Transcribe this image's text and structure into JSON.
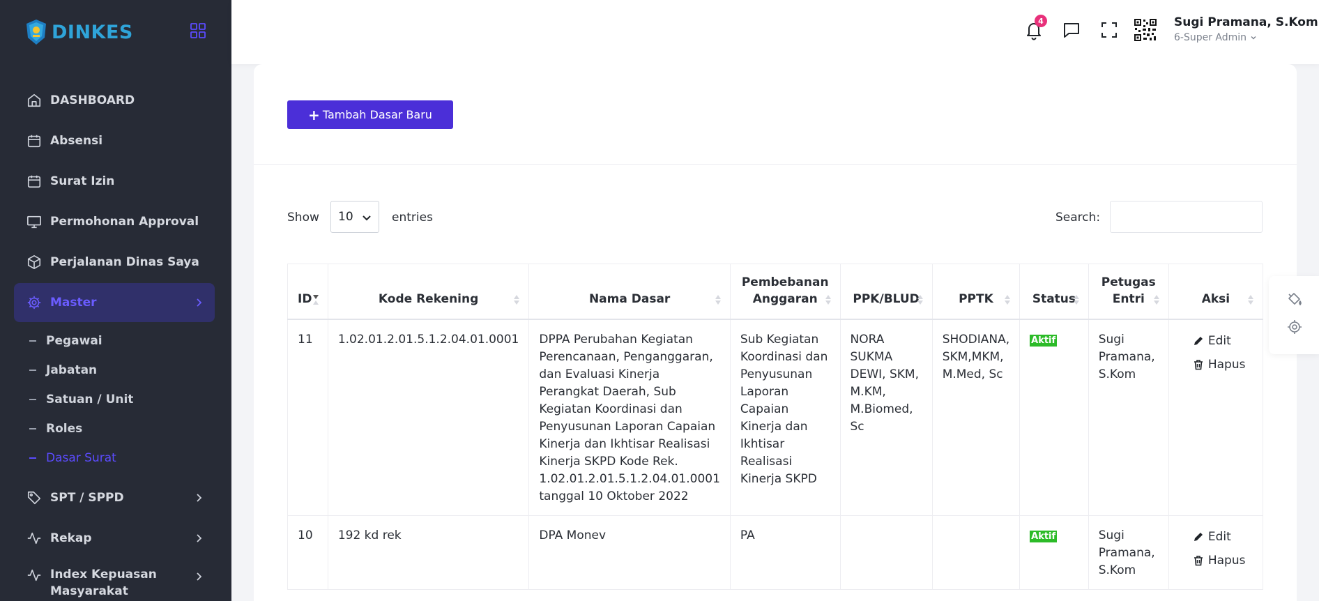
{
  "brand": {
    "name": "DINKES",
    "logo_icon": "dinkes-logo",
    "color": "#2fa4d9"
  },
  "sidebar": {
    "background": "#272b36",
    "accent": "#5b4bff",
    "items": [
      {
        "label": "DASHBOARD",
        "icon": "home-icon"
      },
      {
        "label": "Absensi",
        "icon": "calendar-icon"
      },
      {
        "label": "Surat Izin",
        "icon": "calendar-icon"
      },
      {
        "label": "Permohonan Approval",
        "icon": "monitor-icon"
      },
      {
        "label": "Perjalanan Dinas Saya",
        "icon": "box-icon"
      },
      {
        "label": "Master",
        "icon": "gear-icon",
        "active": true
      }
    ],
    "master_sub": [
      "Pegawai",
      "Jabatan",
      "Satuan / Unit",
      "Roles",
      "Dasar Surat"
    ],
    "lower_items": [
      {
        "label": "SPT / SPPD",
        "icon": "tag-icon"
      },
      {
        "label": "Rekap",
        "icon": "activity-icon"
      },
      {
        "label": "Index Kepuasan Masyarakat",
        "icon": "activity-icon"
      }
    ]
  },
  "topbar": {
    "notification_count": "4",
    "user_name": "Sugi Pramana, S.Kom",
    "user_role": "6-Super Admin"
  },
  "toolbar": {
    "add_label": "Tambah Dasar Baru"
  },
  "table_controls": {
    "show_label": "Show",
    "length_value": "10",
    "entries_label": "entries",
    "search_label": "Search:",
    "search_value": ""
  },
  "table": {
    "headers": [
      "ID",
      "Kode Rekening",
      "Nama Dasar",
      "Pembebanan Anggaran",
      "PPK/BLUD",
      "PPTK",
      "Status",
      "Petugas Entri",
      "Aksi"
    ],
    "rows": [
      {
        "id": "11",
        "kode": "1.02.01.2.01.5.1.2.04.01.0001",
        "nama": "DPPA Perubahan Kegiatan Perencanaan, Penganggaran, dan Evaluasi Kinerja Perangkat Daerah, Sub Kegiatan Koordinasi dan Penyusunan Laporan Capaian Kinerja dan Ikhtisar Realisasi Kinerja SKPD Kode Rek. 1.02.01.2.01.5.1.2.04.01.0001 tanggal 10 Oktober 2022",
        "pembebanan": "Sub Kegiatan Koordinasi dan Penyusunan Laporan Capaian Kinerja dan Ikhtisar Realisasi Kinerja SKPD",
        "ppk": "NORA SUKMA DEWI, SKM, M.KM, M.Biomed, Sc",
        "pptk": "SHODIANA, SKM,MKM, M.Med, Sc",
        "status": "Aktif",
        "petugas": "Sugi Pramana, S.Kom"
      },
      {
        "id": "10",
        "kode": "192 kd rek",
        "nama": "DPA Monev",
        "pembebanan": "PA",
        "ppk": "",
        "pptk": "",
        "status": "Aktif",
        "petugas": "Sugi Pramana, S.Kom"
      }
    ],
    "actions": {
      "edit": "Edit",
      "delete": "Hapus"
    }
  },
  "colors": {
    "primary_button": "#4b2fd8",
    "status_active": "#2cbb28",
    "badge": "#e8307a"
  }
}
